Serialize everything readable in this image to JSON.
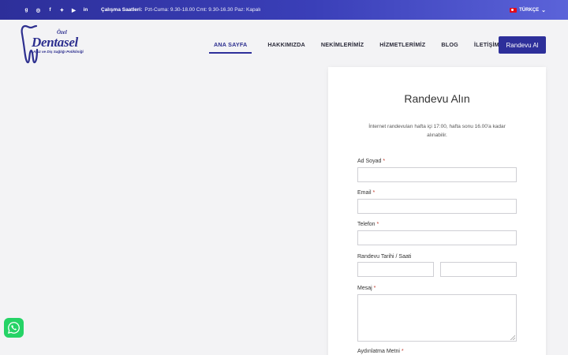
{
  "topbar": {
    "social": [
      {
        "icon": "google-icon",
        "glyph": "g"
      },
      {
        "icon": "instagram-icon",
        "glyph": "◎"
      },
      {
        "icon": "facebook-icon",
        "glyph": "f"
      },
      {
        "icon": "twitter-icon",
        "glyph": "✦"
      },
      {
        "icon": "youtube-icon",
        "glyph": "▶"
      },
      {
        "icon": "linkedin-icon",
        "glyph": "in"
      }
    ],
    "hours_label": "Çalışma Saatleri:",
    "hours_value": "Pzt-Cuma: 9.30-18.00 Cmt: 9.30-16.30 Paz: Kapalı",
    "language": "TÜRKÇE",
    "colors": {
      "gradient_start": "#2d2f9a",
      "gradient_end": "#5b63d9"
    }
  },
  "logo": {
    "ozel": "Özel",
    "brand": "Dentasel",
    "tagline": "Ağız ve Diş Sağlığı Polikliniği",
    "color": "#2d2f8f"
  },
  "nav": {
    "items": [
      {
        "label": "ANA SAYFA",
        "active": true
      },
      {
        "label": "HAKKIMIZDA",
        "active": false
      },
      {
        "label": "NEKİMLERİMİZ",
        "active": false
      },
      {
        "label": "HİZMETLERİMİZ",
        "active": false
      },
      {
        "label": "BLOG",
        "active": false
      },
      {
        "label": "İLETİŞİM",
        "active": false
      }
    ],
    "cta_label": "Randevu Al",
    "accent": "#2d2f9a"
  },
  "form": {
    "title": "Randevu Alın",
    "note": "İnternet randevuları hafta içi 17:00, hafta sonu 16.00'a kadar alınabilir.",
    "required_mark": "*",
    "fields": {
      "name": {
        "label": "Ad Soyad",
        "value": "",
        "placeholder": ""
      },
      "email": {
        "label": "Email",
        "value": "",
        "placeholder": ""
      },
      "phone": {
        "label": "Telefon",
        "value": "",
        "placeholder": ""
      },
      "datetime": {
        "label": "Randevu Tarihi / Saati",
        "date_value": "",
        "time_value": ""
      },
      "message": {
        "label": "Mesaj",
        "value": ""
      },
      "consent": {
        "label": "Aydınlatma Metni"
      }
    }
  },
  "whatsapp": {
    "icon": "whatsapp-icon",
    "color": "#25d366"
  }
}
